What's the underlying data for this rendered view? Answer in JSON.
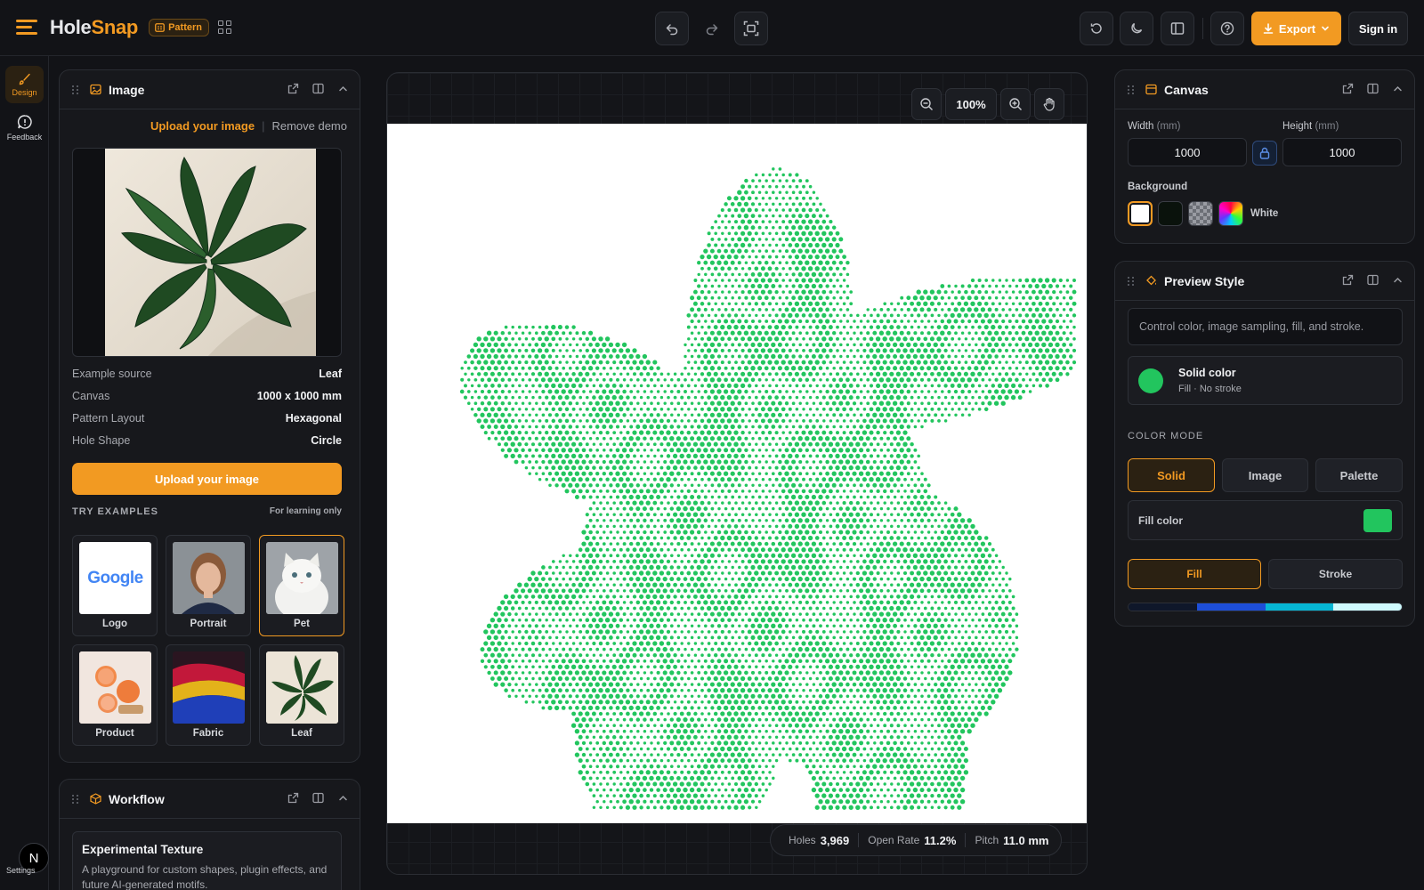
{
  "brand": {
    "name_part1": "Hole",
    "name_part2": "Snap",
    "mode_badge": "Pattern"
  },
  "toolbar": {
    "export_label": "Export",
    "signin_label": "Sign in"
  },
  "rail": {
    "design_label": "Design",
    "feedback_label": "Feedback",
    "settings_label": "Settings",
    "avatar_letter": "N"
  },
  "image_panel": {
    "title": "Image",
    "upload_link": "Upload your image",
    "remove_link": "Remove demo",
    "details": [
      {
        "key": "Example source",
        "value": "Leaf"
      },
      {
        "key": "Canvas",
        "value": "1000 x 1000 mm"
      },
      {
        "key": "Pattern Layout",
        "value": "Hexagonal"
      },
      {
        "key": "Hole Shape",
        "value": "Circle"
      }
    ],
    "upload_button": "Upload your image",
    "examples_title": "TRY EXAMPLES",
    "examples_note": "For learning only",
    "examples": [
      {
        "label": "Logo",
        "logo_text": "Google"
      },
      {
        "label": "Portrait"
      },
      {
        "label": "Pet",
        "selected": true
      },
      {
        "label": "Product"
      },
      {
        "label": "Fabric"
      },
      {
        "label": "Leaf"
      }
    ]
  },
  "workflow_panel": {
    "title": "Workflow",
    "card_title": "Experimental Texture",
    "card_desc": "A playground for custom shapes, plugin effects, and future AI-generated motifs."
  },
  "canvas_view": {
    "zoom": "100%",
    "stats": {
      "holes_label": "Holes",
      "holes_value": "3,969",
      "open_rate_label": "Open Rate",
      "open_rate_value": "11.2%",
      "pitch_label": "Pitch",
      "pitch_value": "11.0 mm"
    },
    "dot_color": "#22c55e"
  },
  "canvas_panel": {
    "title": "Canvas",
    "width_label": "Width",
    "width_unit": "(mm)",
    "width_value": "1000",
    "height_label": "Height",
    "height_unit": "(mm)",
    "height_value": "1000",
    "background_label": "Background",
    "background_value": "White"
  },
  "preview_panel": {
    "title": "Preview Style",
    "hint": "Control color, image sampling, fill, and stroke.",
    "style_name": "Solid color",
    "style_sub": "Fill · No stroke",
    "color_mode_label": "COLOR MODE",
    "modes": [
      "Solid",
      "Image",
      "Palette"
    ],
    "active_mode": "Solid",
    "fill_color_label": "Fill color",
    "fill_color": "#22c55e",
    "fill_stroke": [
      "Fill",
      "Stroke"
    ],
    "gradient_colors": [
      "#0f172a",
      "#1d4ed8",
      "#06b6d4",
      "#cffafe"
    ]
  },
  "colors": {
    "accent": "#f29a22",
    "background": "#121317"
  }
}
